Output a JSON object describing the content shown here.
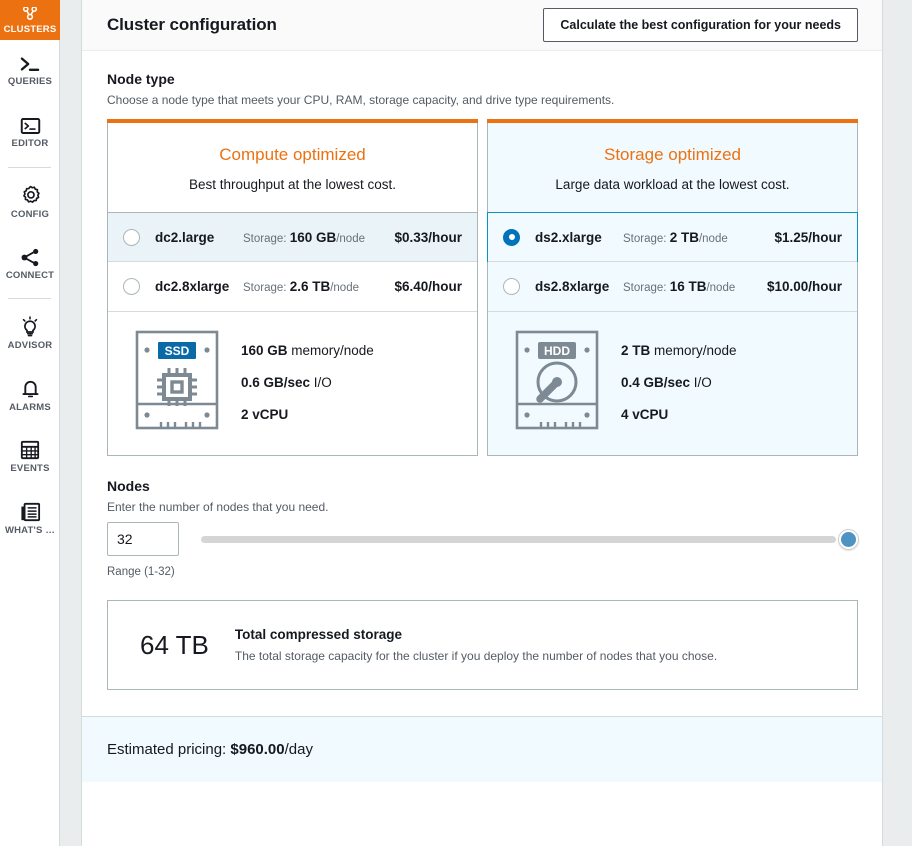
{
  "sidebar": {
    "items": [
      {
        "label": "CLUSTERS",
        "icon": "clusters-icon",
        "active": true
      },
      {
        "label": "QUERIES",
        "icon": "terminal-prompt-icon",
        "active": false
      },
      {
        "label": "EDITOR",
        "icon": "editor-window-icon",
        "active": false
      },
      {
        "label": "CONFIG",
        "icon": "gear-icon",
        "active": false
      },
      {
        "label": "CONNECT",
        "icon": "share-nodes-icon",
        "active": false
      },
      {
        "label": "ADVISOR",
        "icon": "lightbulb-icon",
        "active": false
      },
      {
        "label": "ALARMS",
        "icon": "bell-icon",
        "active": false
      },
      {
        "label": "EVENTS",
        "icon": "calendar-grid-icon",
        "active": false
      },
      {
        "label": "WHAT'S …",
        "icon": "newspaper-icon",
        "active": false
      }
    ]
  },
  "header": {
    "title": "Cluster configuration",
    "calculate_button": "Calculate the best configuration for your needs"
  },
  "node_type": {
    "title": "Node type",
    "description": "Choose a node type that meets your CPU, RAM, storage capacity, and drive type requirements.",
    "cards": [
      {
        "title": "Compute optimized",
        "subtitle": "Best throughput at the lowest cost.",
        "selected": false,
        "drive_badge": "SSD",
        "drive_icon": "ssd-chip-icon",
        "options": [
          {
            "name": "dc2.large",
            "storage_label": "Storage:",
            "storage_value": "160 GB",
            "storage_unit": "/node",
            "price": "$0.33/hour",
            "chosen": false,
            "hover": true
          },
          {
            "name": "dc2.8xlarge",
            "storage_label": "Storage:",
            "storage_value": "2.6 TB",
            "storage_unit": "/node",
            "price": "$6.40/hour",
            "chosen": false,
            "hover": false
          }
        ],
        "specs": [
          {
            "value": "160 GB",
            "rest": " memory/node"
          },
          {
            "value": "0.6 GB/sec",
            "rest": " I/O"
          },
          {
            "value": "2 vCPU",
            "rest": ""
          }
        ]
      },
      {
        "title": "Storage optimized",
        "subtitle": "Large data workload at the lowest cost.",
        "selected": true,
        "drive_badge": "HDD",
        "drive_icon": "hdd-platter-icon",
        "options": [
          {
            "name": "ds2.xlarge",
            "storage_label": "Storage:",
            "storage_value": "2 TB",
            "storage_unit": "/node",
            "price": "$1.25/hour",
            "chosen": true,
            "hover": false
          },
          {
            "name": "ds2.8xlarge",
            "storage_label": "Storage:",
            "storage_value": "16 TB",
            "storage_unit": "/node",
            "price": "$10.00/hour",
            "chosen": false,
            "hover": false
          }
        ],
        "specs": [
          {
            "value": "2 TB",
            "rest": " memory/node"
          },
          {
            "value": "0.4 GB/sec",
            "rest": " I/O"
          },
          {
            "value": "4 vCPU",
            "rest": ""
          }
        ]
      }
    ]
  },
  "nodes": {
    "title": "Nodes",
    "description": "Enter the number of nodes that you need.",
    "value": "32",
    "range_note": "Range (1-32)",
    "slider": {
      "min": 1,
      "max": 32,
      "current": 32,
      "percent": 100
    }
  },
  "total_storage": {
    "value": "64 TB",
    "title": "Total compressed storage",
    "description": "The total storage capacity for the cluster if you deploy the number of nodes that you chose."
  },
  "footer": {
    "label": "Estimated pricing:",
    "amount": "$960.00",
    "suffix": "/day"
  },
  "colors": {
    "accent_orange": "#ec7211",
    "selected_blue": "#0073bb",
    "panel_blue": "#f1faff",
    "slider_blue": "#4d94c4"
  }
}
